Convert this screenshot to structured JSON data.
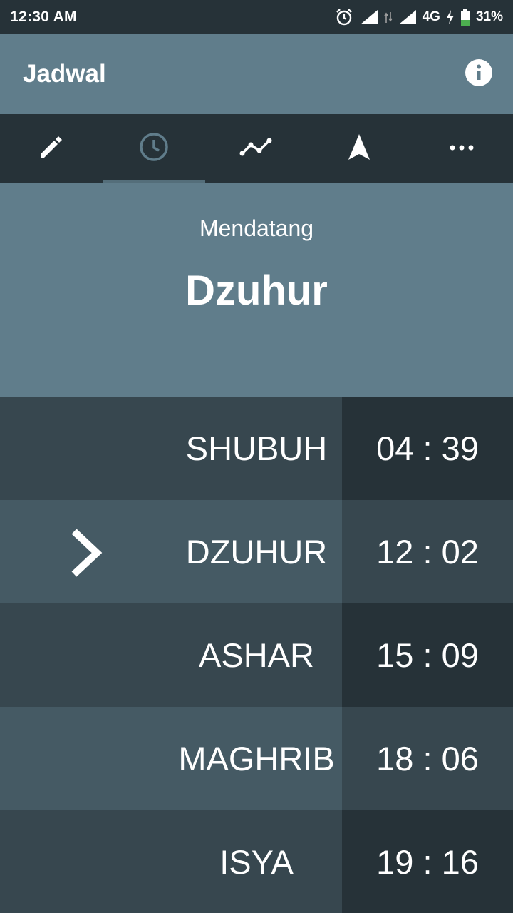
{
  "status_bar": {
    "time": "12:30 AM",
    "network": "4G",
    "battery": "31%",
    "icons": [
      "alarm-icon",
      "signal-icon",
      "data-transfer-icon",
      "signal-icon",
      "charging-icon",
      "battery-icon"
    ]
  },
  "app_bar": {
    "title": "Jadwal",
    "info_icon": "info-icon"
  },
  "tabs": [
    {
      "icon": "pencil-icon",
      "active": false
    },
    {
      "icon": "clock-icon",
      "active": true
    },
    {
      "icon": "line-chart-icon",
      "active": false
    },
    {
      "icon": "navigation-arrow-icon",
      "active": false
    },
    {
      "icon": "more-horizontal-icon",
      "active": false
    }
  ],
  "next_prayer": {
    "label": "Mendatang",
    "name": "Dzuhur"
  },
  "schedule": [
    {
      "name": "SHUBUH",
      "time": "04 : 39",
      "current": false
    },
    {
      "name": "DZUHUR",
      "time": "12 : 02",
      "current": true
    },
    {
      "name": "ASHAR",
      "time": "15 : 09",
      "current": false
    },
    {
      "name": "MAGHRIB",
      "time": "18 : 06",
      "current": false
    },
    {
      "name": "ISYA",
      "time": "19 : 16",
      "current": false
    }
  ],
  "colors": {
    "dark": "#263238",
    "mid": "#37474f",
    "light_row": "#455a64",
    "primary": "#607d8b",
    "battery_green": "#4caf50"
  }
}
